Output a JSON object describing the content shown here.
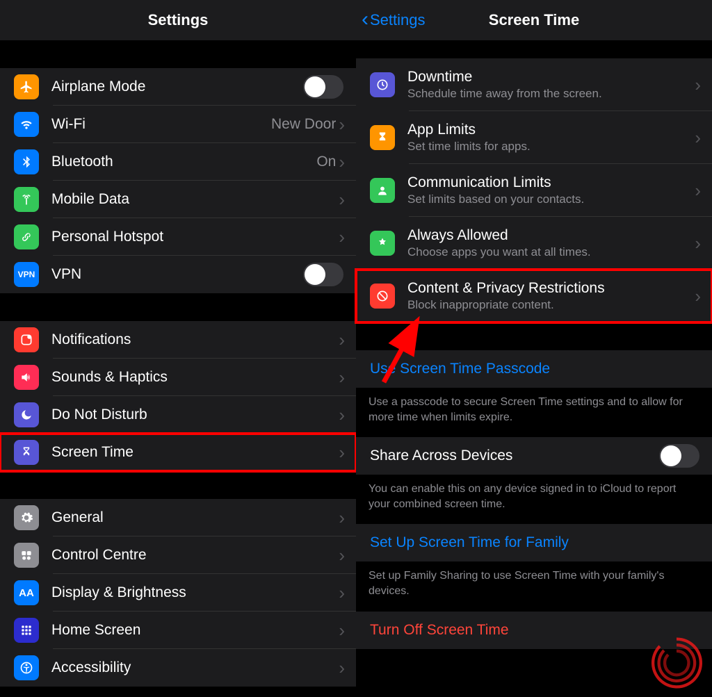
{
  "left": {
    "title": "Settings",
    "group1": [
      {
        "name": "airplane",
        "label": "Airplane Mode",
        "type": "toggle"
      },
      {
        "name": "wifi",
        "label": "Wi-Fi",
        "value": "New Door",
        "type": "link"
      },
      {
        "name": "bluetooth",
        "label": "Bluetooth",
        "value": "On",
        "type": "link"
      },
      {
        "name": "mobile",
        "label": "Mobile Data",
        "type": "link"
      },
      {
        "name": "hotspot",
        "label": "Personal Hotspot",
        "type": "link"
      },
      {
        "name": "vpn",
        "label": "VPN",
        "type": "toggle"
      }
    ],
    "group2": [
      {
        "name": "notifications",
        "label": "Notifications",
        "type": "link"
      },
      {
        "name": "sounds",
        "label": "Sounds & Haptics",
        "type": "link"
      },
      {
        "name": "dnd",
        "label": "Do Not Disturb",
        "type": "link"
      },
      {
        "name": "screentime",
        "label": "Screen Time",
        "type": "link",
        "highlight": true
      }
    ],
    "group3": [
      {
        "name": "general",
        "label": "General",
        "type": "link"
      },
      {
        "name": "control",
        "label": "Control Centre",
        "type": "link"
      },
      {
        "name": "display",
        "label": "Display & Brightness",
        "type": "link"
      },
      {
        "name": "home",
        "label": "Home Screen",
        "type": "link"
      },
      {
        "name": "accessibility",
        "label": "Accessibility",
        "type": "link"
      }
    ]
  },
  "right": {
    "back": "Settings",
    "title": "Screen Time",
    "items": [
      {
        "name": "downtime",
        "label": "Downtime",
        "sub": "Schedule time away from the screen."
      },
      {
        "name": "applimits",
        "label": "App Limits",
        "sub": "Set time limits for apps."
      },
      {
        "name": "commlimits",
        "label": "Communication Limits",
        "sub": "Set limits based on your contacts."
      },
      {
        "name": "always",
        "label": "Always Allowed",
        "sub": "Choose apps you want at all times."
      },
      {
        "name": "content",
        "label": "Content & Privacy Restrictions",
        "sub": "Block inappropriate content.",
        "highlight": true
      }
    ],
    "passcode": {
      "label": "Use Screen Time Passcode",
      "footer": "Use a passcode to secure Screen Time settings and to allow for more time when limits expire."
    },
    "share": {
      "label": "Share Across Devices",
      "footer": "You can enable this on any device signed in to iCloud to report your combined screen time."
    },
    "family": {
      "label": "Set Up Screen Time for Family",
      "footer": "Set up Family Sharing to use Screen Time with your family's devices."
    },
    "turnoff": {
      "label": "Turn Off Screen Time"
    }
  }
}
